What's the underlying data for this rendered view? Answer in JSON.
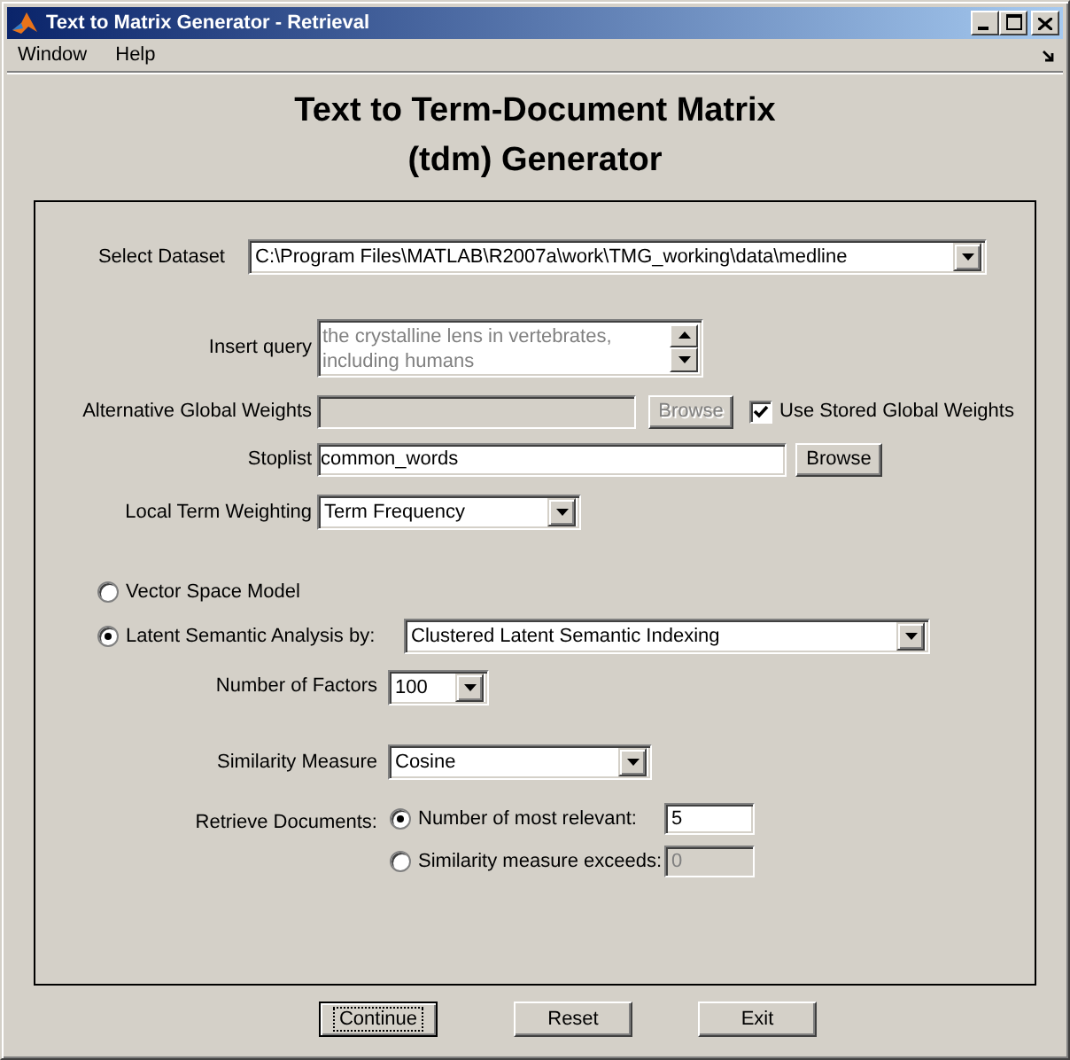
{
  "window": {
    "title": "Text to Matrix Generator - Retrieval",
    "menu": [
      "Window",
      "Help"
    ]
  },
  "heading": [
    "Text to Term-Document Matrix",
    "(tdm) Generator"
  ],
  "dataset": {
    "label": "Select Dataset",
    "value": "C:\\Program Files\\MATLAB\\R2007a\\work\\TMG_working\\data\\medline"
  },
  "query": {
    "label": "Insert query",
    "lines": [
      "the crystalline lens in vertebrates,",
      "including humans"
    ],
    "disabled": true
  },
  "global_weights": {
    "label": "Alternative Global Weights",
    "disabled": true,
    "browse": {
      "label": "Browse",
      "disabled": true
    },
    "use_stored": {
      "label": "Use Stored Global Weights",
      "checked": true
    }
  },
  "stoplist": {
    "label": "Stoplist",
    "value": "common_words",
    "browse": {
      "label": "Browse",
      "disabled": false
    }
  },
  "local_weighting": {
    "label": "Local Term Weighting",
    "value": "Term Frequency"
  },
  "models": [
    {
      "label": "Vector Space Model",
      "selected": false
    },
    {
      "label": "Latent Semantic Analysis by:",
      "selected": true,
      "value": "Clustered Latent Semantic Indexing"
    }
  ],
  "factors": {
    "label": "Number of Factors",
    "value": "100"
  },
  "similarity": {
    "label": "Similarity Measure",
    "value": "Cosine"
  },
  "retrieve": {
    "label": "Retrieve Documents:",
    "options": [
      {
        "label": "Number of most relevant:",
        "selected": true,
        "value": "5"
      },
      {
        "label": "Similarity measure exceeds:",
        "selected": false,
        "value": "0"
      }
    ]
  },
  "buttons": [
    {
      "label": "Continue",
      "focused": true
    },
    {
      "label": "Reset",
      "focused": false
    },
    {
      "label": "Exit",
      "focused": false
    }
  ]
}
